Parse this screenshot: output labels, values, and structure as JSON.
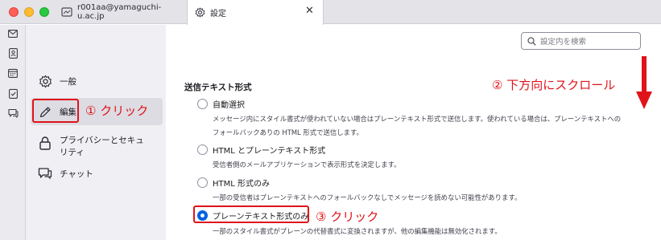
{
  "window": {
    "tabs": [
      {
        "label": "r001aa@yamaguchi-u.ac.jp",
        "icon": "mail-icon"
      },
      {
        "label": "設定",
        "icon": "gear-icon"
      }
    ]
  },
  "search": {
    "placeholder": "設定内を検索"
  },
  "nav": {
    "items": [
      {
        "label": "一般",
        "icon": "gear-icon"
      },
      {
        "label": "編集",
        "icon": "pencil-icon",
        "selected": true
      },
      {
        "label": "プライバシーとセキュリティ",
        "icon": "lock-icon"
      },
      {
        "label": "チャット",
        "icon": "chat-icon"
      }
    ]
  },
  "compose": {
    "section_title": "送信テキスト形式",
    "options": [
      {
        "label": "自動選択",
        "checked": false,
        "desc": [
          "メッセージ内にスタイル書式が使われていない場合はプレーンテキスト形式で送信します。使われている場合は、プレーンテキストへの",
          "フォールバックありの HTML 形式で送信します。"
        ]
      },
      {
        "label": "HTML とプレーンテキスト形式",
        "checked": false,
        "desc": [
          "受信者側のメールアプリケーションで表示形式を決定します。"
        ]
      },
      {
        "label": "HTML 形式のみ",
        "checked": false,
        "desc": [
          "一部の受信者はプレーンテキストへのフォールバックなしでメッセージを読めない可能性があります。"
        ]
      },
      {
        "label": "プレーンテキスト形式のみ",
        "checked": true,
        "desc": [
          "一部のスタイル書式がプレーンの代替書式に変換されますが、他の編集機能は無効化されます。"
        ]
      }
    ]
  },
  "annotations": {
    "step1": "① クリック",
    "step2": "② 下方向にスクロール",
    "step3": "③ クリック",
    "color": "#e0131a"
  },
  "colors": {
    "accent": "#0061e0",
    "annotation": "#e0131a"
  }
}
